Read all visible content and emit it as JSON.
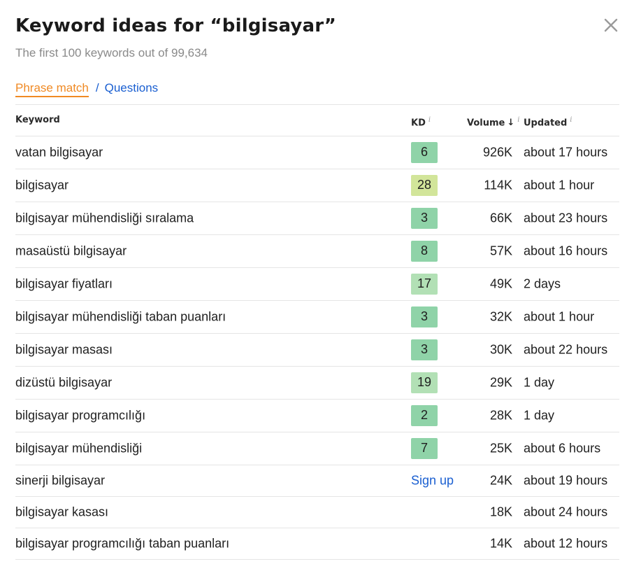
{
  "header": {
    "title": "Keyword ideas for “bilgisayar”",
    "subtitle": "The first 100 keywords out of 99,634"
  },
  "tabs": {
    "active": "Phrase match",
    "separator": "/",
    "other": "Questions"
  },
  "table": {
    "columns": {
      "keyword": "Keyword",
      "kd": "KD",
      "volume": "Volume",
      "updated": "Updated",
      "info_glyph": "i",
      "sort_glyph": "↓"
    },
    "rows": [
      {
        "keyword": "vatan bilgisayar",
        "kd": "6",
        "kd_color": "#8fd3a8",
        "volume": "926K",
        "updated": "about 17 hours"
      },
      {
        "keyword": "bilgisayar",
        "kd": "28",
        "kd_color": "#d2e59a",
        "volume": "114K",
        "updated": "about 1 hour"
      },
      {
        "keyword": "bilgisayar mühendisliği sıralama",
        "kd": "3",
        "kd_color": "#8fd3a8",
        "volume": "66K",
        "updated": "about 23 hours"
      },
      {
        "keyword": "masaüstü bilgisayar",
        "kd": "8",
        "kd_color": "#8fd3a8",
        "volume": "57K",
        "updated": "about 16 hours"
      },
      {
        "keyword": "bilgisayar fiyatları",
        "kd": "17",
        "kd_color": "#b2e0b5",
        "volume": "49K",
        "updated": "2 days"
      },
      {
        "keyword": "bilgisayar mühendisliği taban puanları",
        "kd": "3",
        "kd_color": "#8fd3a8",
        "volume": "32K",
        "updated": "about 1 hour"
      },
      {
        "keyword": "bilgisayar masası",
        "kd": "3",
        "kd_color": "#8fd3a8",
        "volume": "30K",
        "updated": "about 22 hours"
      },
      {
        "keyword": "dizüstü bilgisayar",
        "kd": "19",
        "kd_color": "#b2e0b5",
        "volume": "29K",
        "updated": "1 day"
      },
      {
        "keyword": "bilgisayar programcılığı",
        "kd": "2",
        "kd_color": "#8fd3a8",
        "volume": "28K",
        "updated": "1 day"
      },
      {
        "keyword": "bilgisayar mühendisliği",
        "kd": "7",
        "kd_color": "#8fd3a8",
        "volume": "25K",
        "updated": "about 6 hours"
      },
      {
        "keyword": "sinerji bilgisayar",
        "kd_link": "Sign up",
        "volume": "24K",
        "updated": "about 19 hours"
      },
      {
        "keyword": "bilgisayar kasası",
        "volume": "18K",
        "updated": "about 24 hours"
      },
      {
        "keyword": "bilgisayar programcılığı taban puanları",
        "volume": "14K",
        "updated": "about 12 hours"
      }
    ]
  },
  "colors": {
    "accent_orange": "#f08a24",
    "link_blue": "#1a5fd1"
  }
}
